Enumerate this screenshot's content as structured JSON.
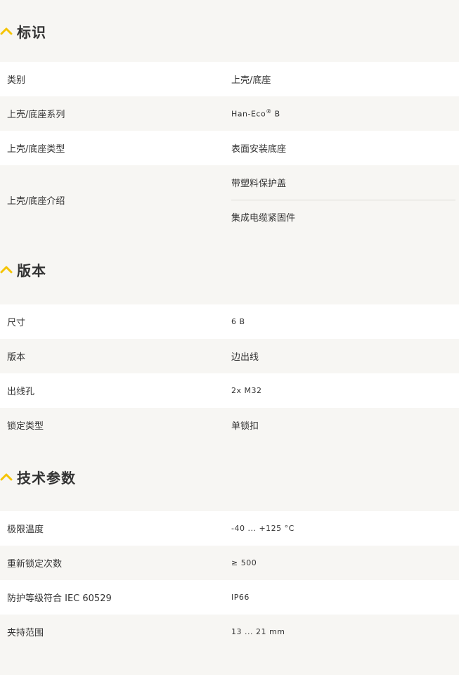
{
  "colors": {
    "accent": "#f5c400",
    "background": "#f7f6f3",
    "row_white": "#ffffff",
    "text": "#333333"
  },
  "sections": [
    {
      "title": "标识",
      "icon": "chevron-up-icon",
      "rows": [
        {
          "label": "类别",
          "value": "上壳/底座"
        },
        {
          "label": "上壳/底座系列",
          "value": "Han-Eco",
          "value_sup": "®",
          "value_suffix": " B"
        },
        {
          "label": "上壳/底座类型",
          "value": "表面安装底座"
        },
        {
          "label": "上壳/底座介绍",
          "values": [
            "带塑料保护盖",
            "集成电缆紧固件"
          ]
        }
      ]
    },
    {
      "title": "版本",
      "icon": "chevron-up-icon",
      "rows": [
        {
          "label": "尺寸",
          "value": "6 B"
        },
        {
          "label": "版本",
          "value": "边出线"
        },
        {
          "label": "出线孔",
          "value": "2x M32"
        },
        {
          "label": "锁定类型",
          "value": "单锁扣"
        }
      ]
    },
    {
      "title": "技术参数",
      "icon": "chevron-up-icon",
      "rows": [
        {
          "label": "极限温度",
          "value": "-40 ... +125 °C"
        },
        {
          "label": "重新锁定次数",
          "value": "≥ 500"
        },
        {
          "label": "防护等级符合 IEC 60529",
          "value": "IP66"
        },
        {
          "label": "夹持范围",
          "value": "13 ... 21 mm"
        }
      ]
    }
  ]
}
